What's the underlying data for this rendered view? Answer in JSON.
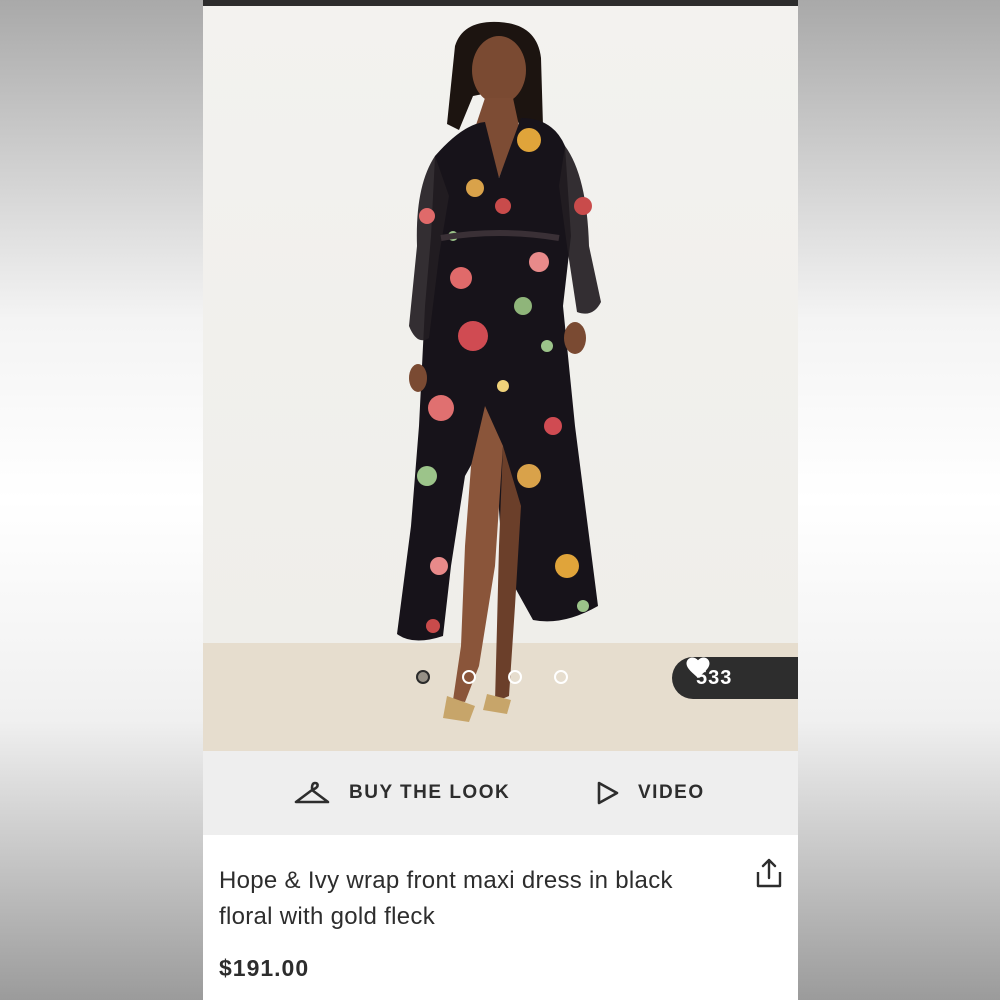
{
  "product": {
    "image_alt": "Model wearing floral wrap maxi dress",
    "likes": "533",
    "carousel": {
      "count": 4,
      "active_index": 0
    },
    "actions": {
      "buy_the_look": "BUY THE LOOK",
      "video": "VIDEO"
    },
    "title": "Hope & Ivy wrap front maxi dress in black floral with gold fleck",
    "price": "$191.00"
  },
  "icons": {
    "heart": "heart-icon",
    "hanger": "hanger-icon",
    "play": "play-icon",
    "share": "share-icon"
  },
  "colors": {
    "dark": "#2d2d2d",
    "action_bar": "#eeeeee",
    "backdrop": "#f3f2ef"
  }
}
